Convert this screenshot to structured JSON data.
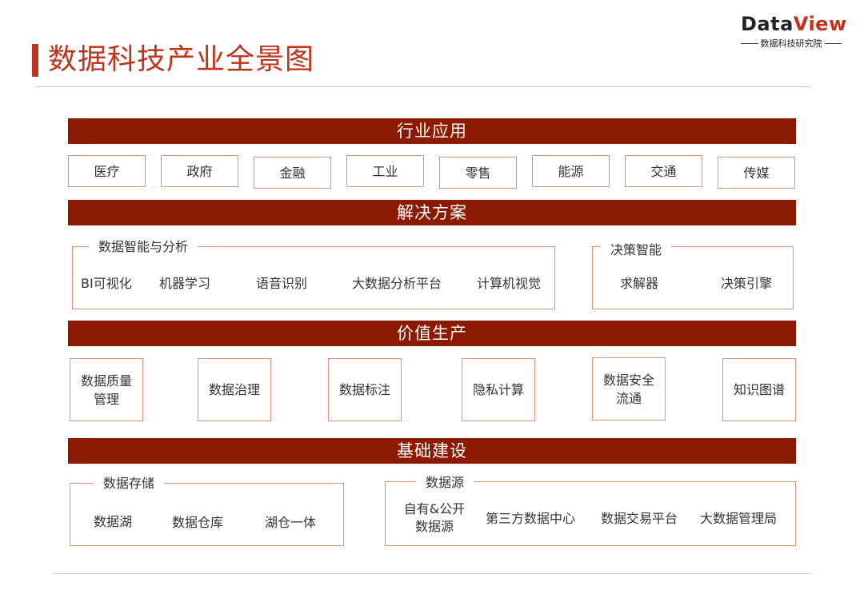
{
  "header": {
    "title": "数据科技产业全景图",
    "logo": {
      "prefix": "Data",
      "suffix": "View",
      "subtitle": "数据科技研究院"
    }
  },
  "colors": {
    "accent": "#c0341d",
    "band": "#8b1a00",
    "border": "#e3937d",
    "divider": "#f0c2b8"
  },
  "sections": {
    "industry": {
      "title": "行业应用",
      "items": [
        "医疗",
        "政府",
        "金融",
        "工业",
        "零售",
        "能源",
        "交通",
        "传媒"
      ]
    },
    "solutions": {
      "title": "解决方案",
      "groups": [
        {
          "label": "数据智能与分析",
          "items": [
            "BI可视化",
            "机器学习",
            "语音识别",
            "大数据分析平台",
            "计算机视觉"
          ]
        },
        {
          "label": "决策智能",
          "items": [
            "求解器",
            "决策引擎"
          ]
        }
      ]
    },
    "value": {
      "title": "价值生产",
      "items": [
        "数据质量\n管理",
        "数据治理",
        "数据标注",
        "隐私计算",
        "数据安全\n流通",
        "知识图谱"
      ]
    },
    "infra": {
      "title": "基础建设",
      "groups": [
        {
          "label": "数据存储",
          "items": [
            "数据湖",
            "数据仓库",
            "湖仓一体"
          ]
        },
        {
          "label": "数据源",
          "items": [
            "自有&公开\n数据源",
            "第三方数据中心",
            "数据交易平台",
            "大数据管理局"
          ]
        }
      ]
    }
  }
}
